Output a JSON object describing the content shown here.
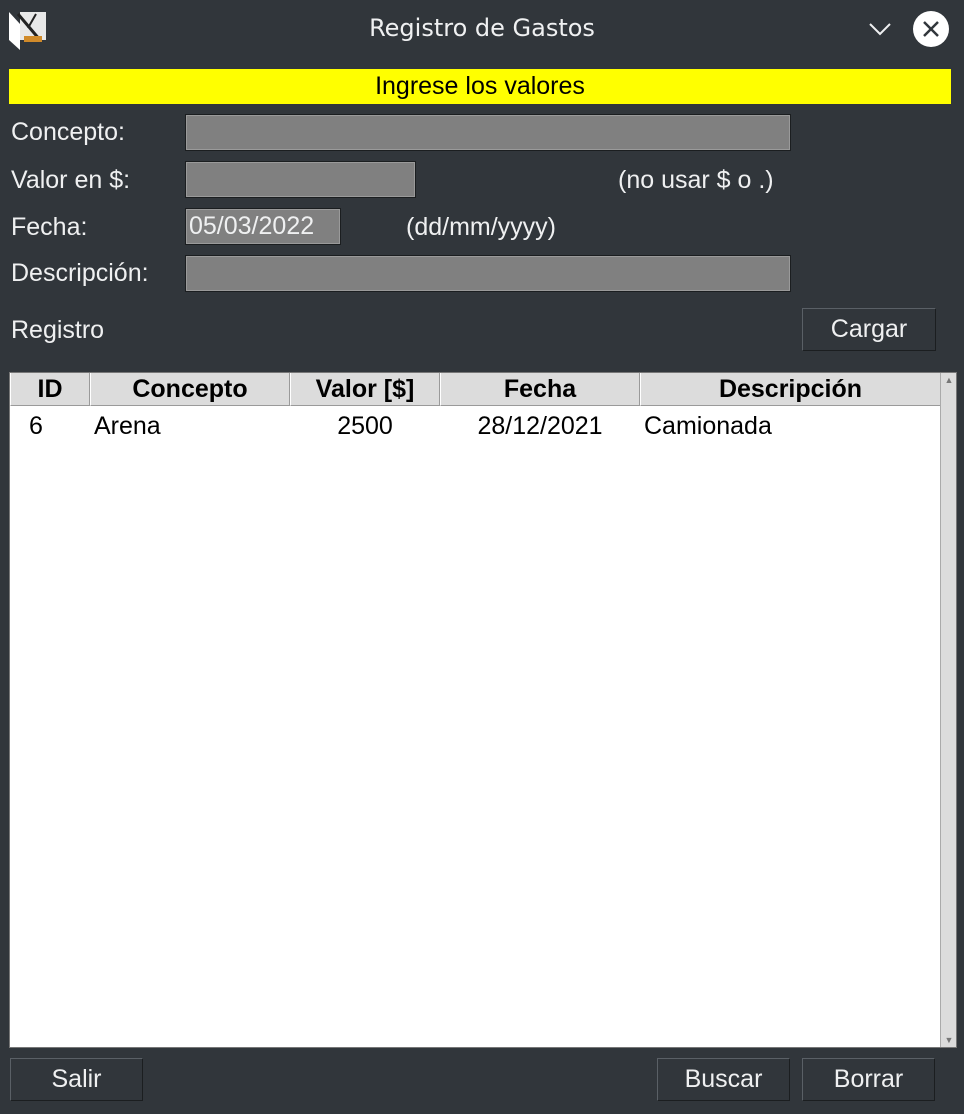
{
  "window": {
    "title": "Registro de Gastos",
    "app_icon": "app-icon",
    "minimize_icon": "chevron-down-icon",
    "close_icon": "close-icon"
  },
  "banner": {
    "text": "Ingrese los valores",
    "color": "#ffff00"
  },
  "form": {
    "concepto_label": "Concepto:",
    "concepto_value": "",
    "valor_label": "Valor en $:",
    "valor_value": "",
    "valor_hint": "(no usar $ o .)",
    "fecha_label": "Fecha:",
    "fecha_value": "05/03/2022",
    "fecha_hint": "(dd/mm/yyyy)",
    "descripcion_label": "Descripción:",
    "descripcion_value": ""
  },
  "registro_label": "Registro",
  "buttons": {
    "cargar": "Cargar",
    "salir": "Salir",
    "buscar": "Buscar",
    "borrar": "Borrar"
  },
  "table": {
    "columns": [
      "ID",
      "Concepto",
      "Valor [$]",
      "Fecha",
      "Descripción"
    ],
    "rows": [
      {
        "id": "6",
        "concepto": "Arena",
        "valor": "2500",
        "fecha": "28/12/2021",
        "descripcion": "Camionada"
      }
    ]
  }
}
